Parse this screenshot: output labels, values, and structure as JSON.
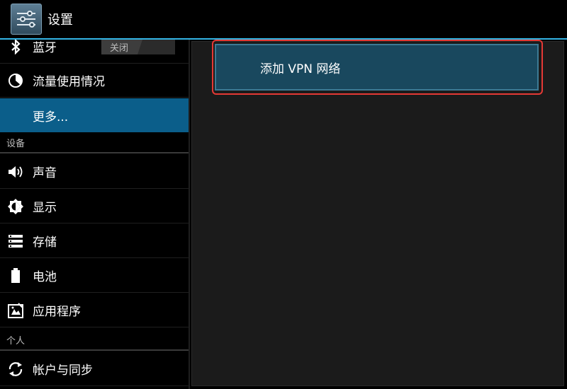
{
  "actionbar": {
    "title": "设置",
    "icon": "settings-sliders-icon",
    "accent": "#33b5e5"
  },
  "sidebar": {
    "bluetooth": {
      "label": "蓝牙",
      "icon": "bluetooth-icon",
      "toggle": "关闭"
    },
    "data_usage": {
      "label": "流量使用情况",
      "icon": "data-usage-icon"
    },
    "more": {
      "label": "更多...",
      "selected": true,
      "selected_color": "#0b5e8a"
    },
    "section_device": "设备",
    "sound": {
      "label": "声音",
      "icon": "speaker-icon"
    },
    "display": {
      "label": "显示",
      "icon": "brightness-icon"
    },
    "storage": {
      "label": "存储",
      "icon": "storage-icon"
    },
    "battery": {
      "label": "电池",
      "icon": "battery-icon"
    },
    "apps": {
      "label": "应用程序",
      "icon": "apps-icon"
    },
    "section_personal": "个人",
    "accounts": {
      "label": "帐户与同步",
      "icon": "sync-icon"
    }
  },
  "main": {
    "add_vpn": {
      "label": "添加 VPN 网络",
      "highlight_color": "#e53935"
    }
  }
}
